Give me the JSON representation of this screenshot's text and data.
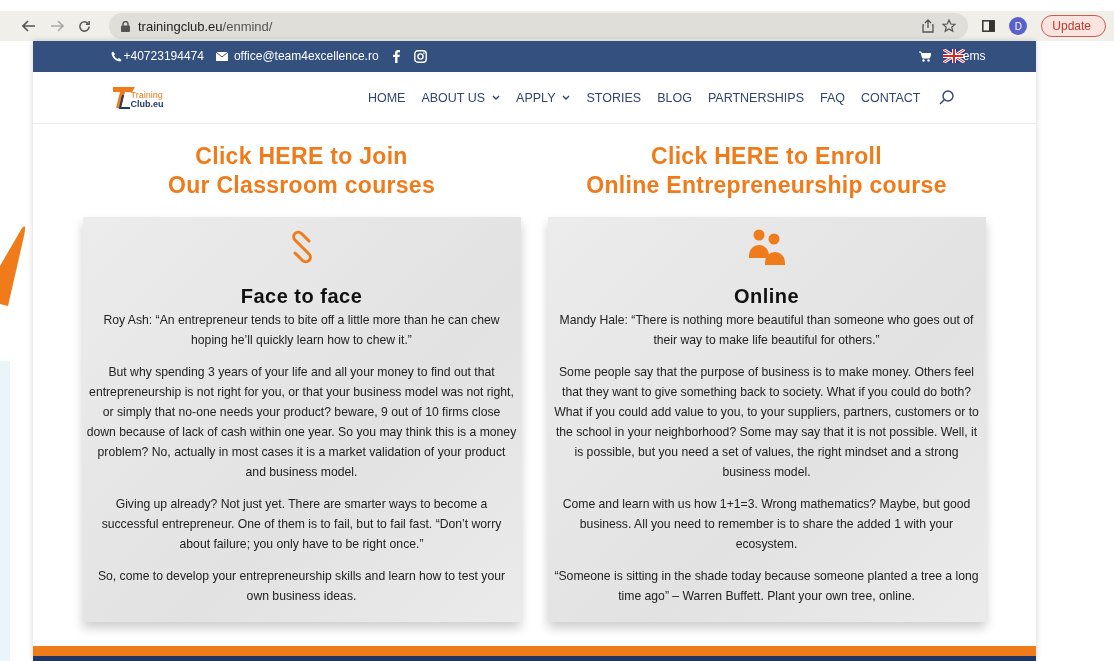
{
  "browser": {
    "url_host": "trainingclub.eu",
    "url_path": "/enmind/",
    "profile_initial": "D",
    "update_label": "Update"
  },
  "topbar": {
    "phone": "+40723194474",
    "email": "office@team4excellence.ro",
    "cart_text": "ems"
  },
  "logo": {
    "line1": "Training",
    "line2": "Club.eu"
  },
  "nav": [
    {
      "label": "HOME",
      "dropdown": false
    },
    {
      "label": "ABOUT US",
      "dropdown": true
    },
    {
      "label": "APPLY",
      "dropdown": true
    },
    {
      "label": "STORIES",
      "dropdown": false
    },
    {
      "label": "BLOG",
      "dropdown": false
    },
    {
      "label": "PARTNERSHIPS",
      "dropdown": false
    },
    {
      "label": "FAQ",
      "dropdown": false
    },
    {
      "label": "CONTACT",
      "dropdown": false
    }
  ],
  "columns": [
    {
      "heading": [
        "Click HERE to Join",
        "Our Classroom courses"
      ],
      "kind": "classroom",
      "title": "Face to face",
      "paragraphs": [
        "Roy Ash: “An entrepreneur tends to bite off a little more than he can chew hoping he’ll quickly learn how to chew it.”",
        "But why spending 3 years of your life and all your money to find out that entrepreneurship is not right for you, or that your business model was not right, or simply that no-one needs your product? beware, 9 out of 10 firms close down because of lack of cash within one year. So you may think this is a money problem? No, actually in most cases it is a market validation of your product and business model.",
        "Giving up already? Not just yet. There are smarter ways to become a successful entrepreneur. One of them is to fail, but to fail fast. “Don’t worry about failure; you only have to be right once.”",
        "So, come to develop your entrepreneurship skills and learn how to test your own business ideas."
      ]
    },
    {
      "heading": [
        "Click HERE to Enroll",
        "Online Entrepreneurship course"
      ],
      "kind": "online",
      "title": "Online",
      "paragraphs": [
        "Mandy Hale: “There is nothing more beautiful than someone who goes out of their way to make life beautiful for others.”",
        "Some people say that the purpose of business is to make money. Others feel that they want to give something back to society. What if you could do both? What if you could add value to you, to your suppliers, partners, customers or to the school in your neighborhood? Some may say that it is not possible. Well, it is possible, but you need a set of values, the right mindset and a strong business model.",
        "Come and learn with us how 1+1=3. Wrong mathematics? Maybe, but good business. All you need to remember is to share the added 1 with your ecosystem.",
        "“Someone is sitting in the shade today because someone planted a tree a long time ago” – Warren Buffett. Plant your own tree, online."
      ]
    }
  ]
}
